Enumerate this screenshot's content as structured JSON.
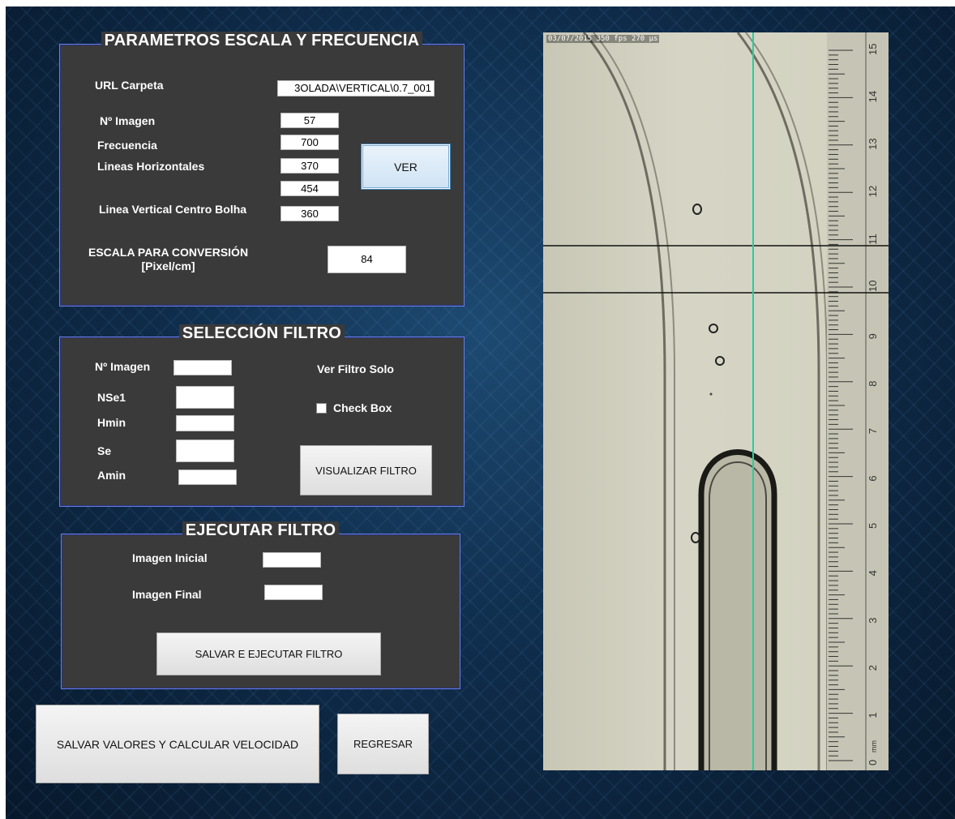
{
  "escala": {
    "title": "PARAMETROS ESCALA Y FRECUENCIA",
    "url_label": "URL Carpeta",
    "url_value": "3OLADA\\VERTICAL\\0.7_001",
    "nimagen_label": "Nº Imagen",
    "nimagen_value": "57",
    "frecuencia_label": "Frecuencia",
    "frecuencia_value": "700",
    "lineas_label": "Lineas Horizontales",
    "linea1_value": "370",
    "linea2_value": "454",
    "vertical_label": "Linea Vertical Centro Bolha",
    "vertical_value": "360",
    "escala_label_1": "ESCALA PARA CONVERSIÓN",
    "escala_label_2": "[Pixel/cm]",
    "escala_value": "84",
    "ver_button": "VER"
  },
  "filtro": {
    "title": "SELECCIÓN FILTRO",
    "nimagen_label": "Nº Imagen",
    "nse1_label": "NSe1",
    "hmin_label": "Hmin",
    "se_label": "Se",
    "amin_label": "Amin",
    "nimagen_value": "",
    "nse1_value": "",
    "hmin_value": "",
    "se_value": "",
    "amin_value": "",
    "ver_filtro_label": "Ver Filtro Solo",
    "checkbox_label": "Check Box",
    "checkbox_checked": false,
    "visualizar_button": "VISUALIZAR  FILTRO"
  },
  "ejecutar": {
    "title": "EJECUTAR FILTRO",
    "inicial_label": "Imagen Inicial",
    "final_label": "Imagen Final",
    "inicial_value": "",
    "final_value": "",
    "salvar_button": "SALVAR E EJECUTAR  FILTRO"
  },
  "footer": {
    "salvar_valores_button": "SALVAR VALORES  Y CALCULAR VELOCIDAD",
    "regresar_button": "REGRESAR"
  },
  "photo": {
    "timestamp": "03/07/2015  350 fps  270 µs",
    "ruler_numbers": [
      "15",
      "14",
      "13",
      "12",
      "11",
      "10",
      "9",
      "8",
      "7",
      "6",
      "5",
      "4",
      "3",
      "2",
      "1",
      "0"
    ],
    "ruler_unit": "mm",
    "colors": {
      "vertical_line": "#2ecc9a",
      "horizontal_lines": "#111111"
    }
  }
}
